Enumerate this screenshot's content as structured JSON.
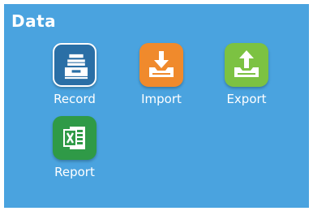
{
  "screen": {
    "title": "Data",
    "background_color": "#4aa3df"
  },
  "tiles": [
    {
      "label": "Record",
      "icon": "cash-register-icon",
      "color": "#2a6fa6",
      "selected": true
    },
    {
      "label": "Import",
      "icon": "import-tray-icon",
      "color": "#f08a2c",
      "selected": false
    },
    {
      "label": "Export",
      "icon": "export-tray-icon",
      "color": "#7cc242",
      "selected": false
    },
    {
      "label": "Report",
      "icon": "excel-report-icon",
      "color": "#2f9a47",
      "selected": false
    }
  ]
}
